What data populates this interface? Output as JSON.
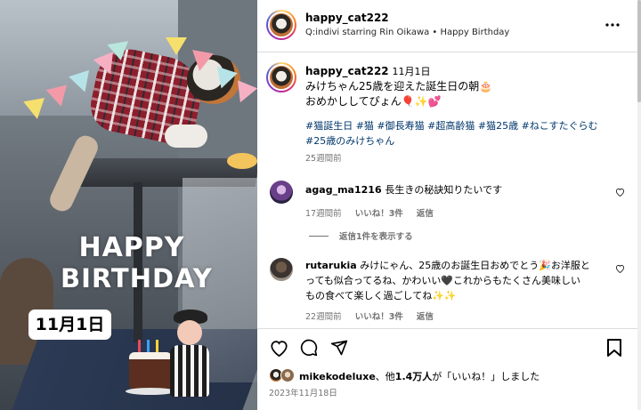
{
  "media": {
    "overlay_line1": "HAPPY",
    "overlay_line2": "BIRTHDAY",
    "date_badge": "11月1日"
  },
  "header": {
    "username": "happy_cat222",
    "subtitle": "Q:indivi starring Rin Oikawa • Happy Birthday",
    "more_icon": "more-horizontal-icon"
  },
  "caption": {
    "username": "happy_cat222",
    "date": "11月1日",
    "line1": "みけちゃん25歳を迎えた誕生日の朝🎂",
    "line2": "おめかししてぴょん🎈✨💕",
    "hashtags1": "#猫誕生日 #猫 #御長寿猫 #超高齢猫 #猫25歳 #ねこすたぐらむ",
    "hashtags2": "#25歳のみけちゃん",
    "age": "25週間前"
  },
  "comments": [
    {
      "username": "agag_ma1216",
      "text": "長生きの秘訣知りたいです",
      "age": "17週間前",
      "likes": "いいね！3件",
      "reply": "返信"
    },
    {
      "username": "rutarukia",
      "text_line1": "みけにゃん、25歳のお誕生日おめでとう🎉お洋服と",
      "text_line2": "っても似合ってるね、かわいい🖤これからもたくさん美味しい",
      "text_line3": "もの食べて楽しく過ごしてね✨✨",
      "age": "22週間前",
      "likes": "いいね！3件",
      "reply": "返信"
    }
  ],
  "view_replies": "返信1件を表示する",
  "actions": {
    "like_icon": "heart-icon",
    "comment_icon": "comment-icon",
    "share_icon": "send-icon",
    "save_icon": "bookmark-icon"
  },
  "likes_line": {
    "user": "mikekodeluxe",
    "middle": "、他",
    "count": "1.4万人",
    "suffix": "が「いいね！」しました"
  },
  "post_date": "2023年11月18日",
  "colors": {
    "hashtag": "#00376b",
    "muted": "#737373",
    "divider": "#dbdbdb"
  }
}
